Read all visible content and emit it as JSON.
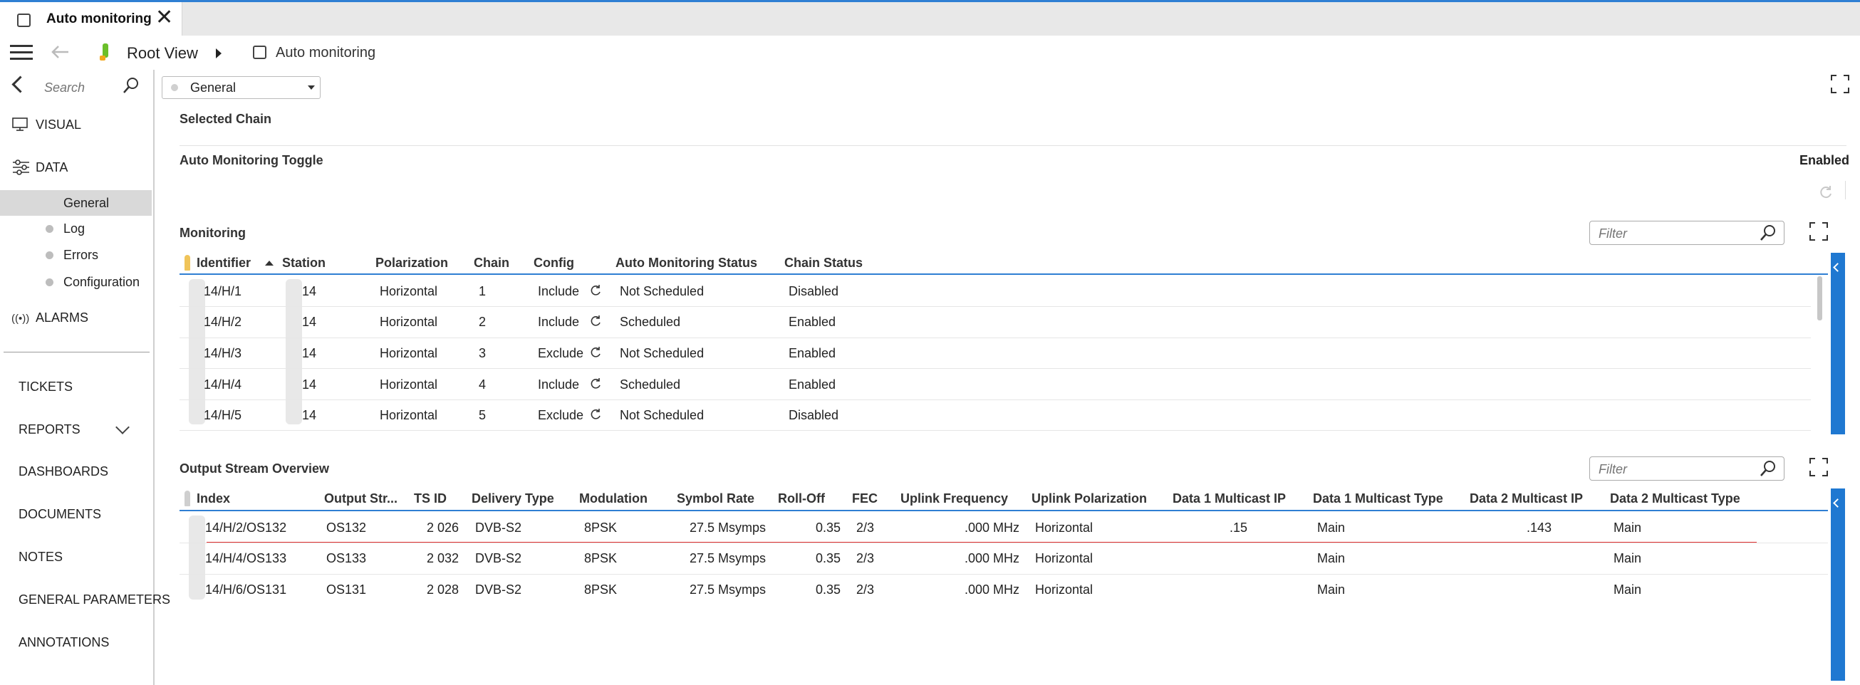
{
  "window": {
    "tab_title": "Auto monitoring",
    "close_glyph": "✕"
  },
  "toolbar": {
    "root_view": "Root View",
    "page_name": "Auto monitoring"
  },
  "sidebar": {
    "search_placeholder": "Search",
    "visual": "VISUAL",
    "data": "DATA",
    "sub_items": [
      "General",
      "Log",
      "Errors",
      "Configuration"
    ],
    "alarms": "ALARMS",
    "sections": [
      "TICKETS",
      "REPORTS",
      "DASHBOARDS",
      "DOCUMENTS",
      "NOTES",
      "GENERAL PARAMETERS",
      "ANNOTATIONS"
    ]
  },
  "main": {
    "page_select": "General",
    "selected_chain": "Selected Chain",
    "toggle_label": "Auto Monitoring Toggle",
    "toggle_value": "Enabled",
    "monitoring_title": "Monitoring",
    "filter_placeholder": "Filter",
    "output_title": "Output Stream Overview"
  },
  "monitoring": {
    "headers": [
      "Identifier",
      "Station",
      "Polarization",
      "Chain",
      "Config",
      "Auto Monitoring Status",
      "Chain Status"
    ],
    "rows": [
      {
        "id": "14/H/1",
        "station": "14",
        "pol": "Horizontal",
        "chain": "1",
        "config": "Include",
        "ams": "Not Scheduled",
        "status": "Disabled"
      },
      {
        "id": "14/H/2",
        "station": "14",
        "pol": "Horizontal",
        "chain": "2",
        "config": "Include",
        "ams": "Scheduled",
        "status": "Enabled"
      },
      {
        "id": "14/H/3",
        "station": "14",
        "pol": "Horizontal",
        "chain": "3",
        "config": "Exclude",
        "ams": "Not Scheduled",
        "status": "Enabled"
      },
      {
        "id": "14/H/4",
        "station": "14",
        "pol": "Horizontal",
        "chain": "4",
        "config": "Include",
        "ams": "Scheduled",
        "status": "Enabled"
      },
      {
        "id": "14/H/5",
        "station": "14",
        "pol": "Horizontal",
        "chain": "5",
        "config": "Exclude",
        "ams": "Not Scheduled",
        "status": "Disabled"
      }
    ]
  },
  "output": {
    "headers": [
      "Index",
      "Output Str...",
      "TS ID",
      "Delivery Type",
      "Modulation",
      "Symbol Rate",
      "Roll-Off",
      "FEC",
      "Uplink Frequency",
      "Uplink Polarization",
      "Data 1 Multicast IP",
      "Data 1 Multicast Type",
      "Data 2 Multicast IP",
      "Data 2 Multicast Type"
    ],
    "rows": [
      {
        "index": "14/H/2/OS132",
        "os": "OS132",
        "tsid": "2 026",
        "dtype": "DVB-S2",
        "mod": "8PSK",
        "sr": "27.5 Msymps",
        "ro": "0.35",
        "fec": "2/3",
        "uf": ".000 MHz",
        "up": "Horizontal",
        "d1ip": ".15",
        "d1t": "Main",
        "d2ip": ".143",
        "d2t": "Main"
      },
      {
        "index": "14/H/4/OS133",
        "os": "OS133",
        "tsid": "2 032",
        "dtype": "DVB-S2",
        "mod": "8PSK",
        "sr": "27.5 Msymps",
        "ro": "0.35",
        "fec": "2/3",
        "uf": ".000 MHz",
        "up": "Horizontal",
        "d1ip": "",
        "d1t": "Main",
        "d2ip": "",
        "d2t": "Main"
      },
      {
        "index": "14/H/6/OS131",
        "os": "OS131",
        "tsid": "2 028",
        "dtype": "DVB-S2",
        "mod": "8PSK",
        "sr": "27.5 Msymps",
        "ro": "0.35",
        "fec": "2/3",
        "uf": ".000 MHz",
        "up": "Horizontal",
        "d1ip": "",
        "d1t": "Main",
        "d2ip": "",
        "d2t": "Main"
      }
    ]
  },
  "colors": {
    "accent": "#2f7fd3",
    "selection_underline": "#e03030"
  }
}
